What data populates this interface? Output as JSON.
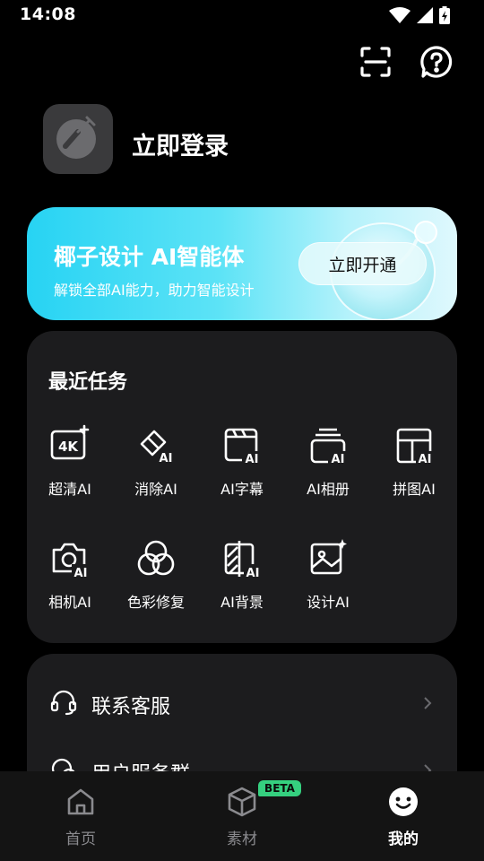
{
  "status_bar": {
    "time": "14:08"
  },
  "profile": {
    "login_text": "立即登录"
  },
  "ai_banner": {
    "title": "椰子设计 AI智能体",
    "subtitle": "解锁全部AI能力，助力智能设计",
    "button": "立即开通"
  },
  "recent_tasks": {
    "title": "最近任务",
    "items": [
      {
        "label": "超清AI",
        "icon": "4k-ai-icon"
      },
      {
        "label": "消除AI",
        "icon": "eraser-ai-icon"
      },
      {
        "label": "AI字幕",
        "icon": "subtitle-ai-icon"
      },
      {
        "label": "AI相册",
        "icon": "album-ai-icon"
      },
      {
        "label": "拼图AI",
        "icon": "collage-ai-icon"
      },
      {
        "label": "相机AI",
        "icon": "camera-ai-icon"
      },
      {
        "label": "色彩修复",
        "icon": "color-circles-icon"
      },
      {
        "label": "AI背景",
        "icon": "background-ai-icon"
      },
      {
        "label": "设计AI",
        "icon": "design-image-icon"
      }
    ]
  },
  "services": {
    "items": [
      {
        "label": "联系客服",
        "icon": "headset-icon"
      },
      {
        "label": "用户服务群",
        "icon": "chat-group-icon"
      }
    ]
  },
  "tab_bar": {
    "items": [
      {
        "label": "首页",
        "icon": "home-icon"
      },
      {
        "label": "素材",
        "icon": "cube-icon",
        "badge": "BETA"
      },
      {
        "label": "我的",
        "icon": "smile-icon"
      }
    ],
    "active": "我的",
    "badge_color": "#35d07f"
  },
  "colors": {
    "background": "#000000",
    "card": "#1c1c1e",
    "banner_start": "#27d3f3",
    "banner_end": "#dff8fd"
  }
}
